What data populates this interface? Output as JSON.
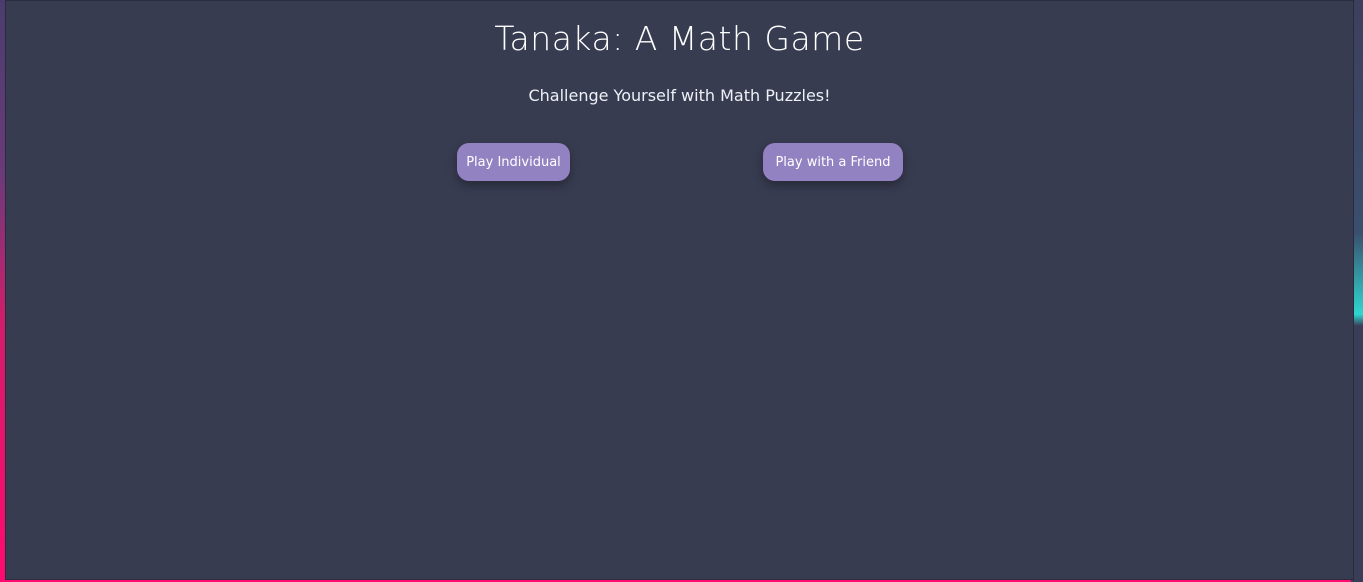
{
  "header": {
    "title": "Tanaka: A Math Game",
    "subtitle": "Challenge Yourself with Math Puzzles!"
  },
  "actions": {
    "play_individual_label": "Play Individual",
    "play_with_friend_label": "Play with a Friend"
  },
  "colors": {
    "panel_background": "#383c51",
    "button_background": "#9382c2",
    "text": "#ffffff"
  }
}
